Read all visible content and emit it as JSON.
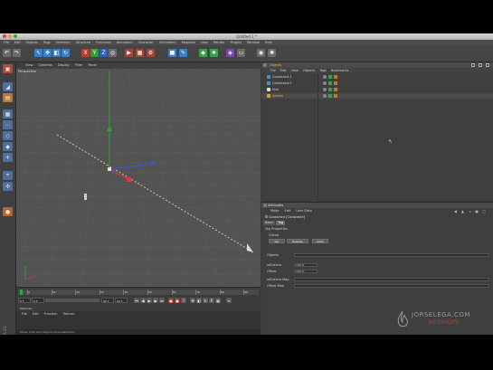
{
  "window": {
    "title": "Untitled 1 *",
    "traffic_colors": [
      "#e0443e",
      "#dea123",
      "#27aa35"
    ]
  },
  "menubar": [
    "File",
    "Edit",
    "Objects",
    "Tags",
    "Selection",
    "Structure",
    "Functions",
    "Animation",
    "Character",
    "Simulation",
    "Mograph",
    "User",
    "Render",
    "Plugins",
    "Window",
    "Help"
  ],
  "toolbar_icons": [
    {
      "name": "undo-icon",
      "glyph": "↶",
      "color": "#6a6a6a"
    },
    {
      "name": "redo-icon",
      "glyph": "↷",
      "color": "#6a6a6a"
    },
    {
      "name": "live-selection-icon",
      "glyph": "↖",
      "color": "#3d7fc4"
    },
    {
      "name": "move-icon",
      "glyph": "✥",
      "color": "#3d7fc4"
    },
    {
      "name": "scale-icon",
      "glyph": "◧",
      "color": "#3d7fc4"
    },
    {
      "name": "rotate-icon",
      "glyph": "↻",
      "color": "#3d7fc4"
    },
    {
      "name": "x-axis-icon",
      "glyph": "X",
      "color": "#b04030"
    },
    {
      "name": "y-axis-icon",
      "glyph": "Y",
      "color": "#3a9a3a"
    },
    {
      "name": "z-axis-icon",
      "glyph": "Z",
      "color": "#3060b0"
    },
    {
      "name": "world-coords-icon",
      "glyph": "◎",
      "color": "#6a6a6a"
    },
    {
      "name": "render-view-icon",
      "glyph": "▶",
      "color": "#a04838"
    },
    {
      "name": "render-picture-viewer-icon",
      "glyph": "▦",
      "color": "#a04838"
    },
    {
      "name": "render-settings-icon",
      "glyph": "⚙",
      "color": "#a04838"
    },
    {
      "name": "cube-icon",
      "glyph": "■",
      "color": "#3d7fc4"
    },
    {
      "name": "pen-icon",
      "glyph": "✎",
      "color": "#3d7fc4"
    },
    {
      "name": "subdivision-icon",
      "glyph": "◆",
      "color": "#3aa04a"
    },
    {
      "name": "array-icon",
      "glyph": "❖",
      "color": "#3aa04a"
    },
    {
      "name": "deformer-icon",
      "glyph": "◈",
      "color": "#7a4ab0"
    },
    {
      "name": "floor-icon",
      "glyph": "▭",
      "color": "#6a6a6a"
    },
    {
      "name": "camera-icon",
      "glyph": "◉",
      "color": "#6a6a6a"
    },
    {
      "name": "light-icon",
      "glyph": "✺",
      "color": "#6a6a6a"
    }
  ],
  "left_tools": [
    {
      "name": "make-editable-icon",
      "glyph": "▣",
      "color": "#b04838"
    },
    {
      "name": "model-mode-icon",
      "glyph": "◢",
      "color": "#4a6fa0"
    },
    {
      "name": "texture-mode-icon",
      "glyph": "▤",
      "color": "#c07830"
    },
    {
      "name": "workplane-icon",
      "glyph": "▦",
      "color": "#4a6fa0"
    },
    {
      "name": "points-mode-icon",
      "glyph": "⋯",
      "color": "#4a6fa0"
    },
    {
      "name": "edges-mode-icon",
      "glyph": "◇",
      "color": "#4a6fa0"
    },
    {
      "name": "polygons-mode-icon",
      "glyph": "◆",
      "color": "#4a6fa0"
    },
    {
      "name": "axis-mode-icon",
      "glyph": "✛",
      "color": "#4a6fa0"
    },
    {
      "name": "tweak-mode-icon",
      "glyph": "⌖",
      "color": "#4a6fa0"
    },
    {
      "name": "snap-icon",
      "glyph": "✣",
      "color": "#4a6fa0"
    },
    {
      "name": "sculpt-icon",
      "glyph": "●",
      "color": "#c06030"
    }
  ],
  "left_panel_vertical_label": "MAXON CINEMA 4D",
  "viewport": {
    "menu": [
      "View",
      "Cameras",
      "Display",
      "Filter",
      "Panel"
    ],
    "label": "Perspective",
    "bg": "#535353",
    "grid": "#5e5e5e"
  },
  "timeline": {
    "ticks": [
      "0",
      "10",
      "20",
      "30",
      "40",
      "50",
      "60",
      "70",
      "80",
      "90"
    ],
    "start_field": "0 F",
    "current_field": "0 F",
    "end_field": "90 F",
    "end2_field": "90 F"
  },
  "materials": {
    "title": "Materials",
    "menu": [
      "File",
      "Edit",
      "Function",
      "Texture"
    ]
  },
  "statusbar": "Move: Click and drag to move elements.",
  "objects": {
    "header": "Objects",
    "menu": [
      "File",
      "Edit",
      "View",
      "Objects",
      "Tags",
      "Bookmarks"
    ],
    "rows": [
      {
        "name": "Constraint.1",
        "icon_color": "#4a90d0"
      },
      {
        "name": "Constraint.2",
        "icon_color": "#4a90d0"
      },
      {
        "name": "Null",
        "icon_color": "#e0e0e0"
      },
      {
        "name": "Sphere",
        "icon_color": "#d8a030"
      }
    ]
  },
  "attributes": {
    "header": "Attributes",
    "menu": [
      "Mode",
      "Edit",
      "User Data"
    ],
    "title": "Constraint [Constraint]",
    "tabs": [
      {
        "label": "Basic",
        "active": false
      },
      {
        "label": "Tag",
        "active": true
      }
    ],
    "section": "Tag Properties",
    "sub_section": "Clamp",
    "buttons": [
      "Set",
      "Release",
      "Clear"
    ],
    "rows": [
      {
        "label": "Objects",
        "value": ""
      },
      {
        "label": "Influence",
        "value": "100 %"
      },
      {
        "label": "Offset",
        "value": "100 %"
      },
      {
        "label": "Influence Map",
        "value": ""
      },
      {
        "label": "Offset Map",
        "value": ""
      }
    ]
  },
  "watermark": {
    "brand": "JORSELEGA.COM",
    "tagline": "WEBSHOPS"
  }
}
